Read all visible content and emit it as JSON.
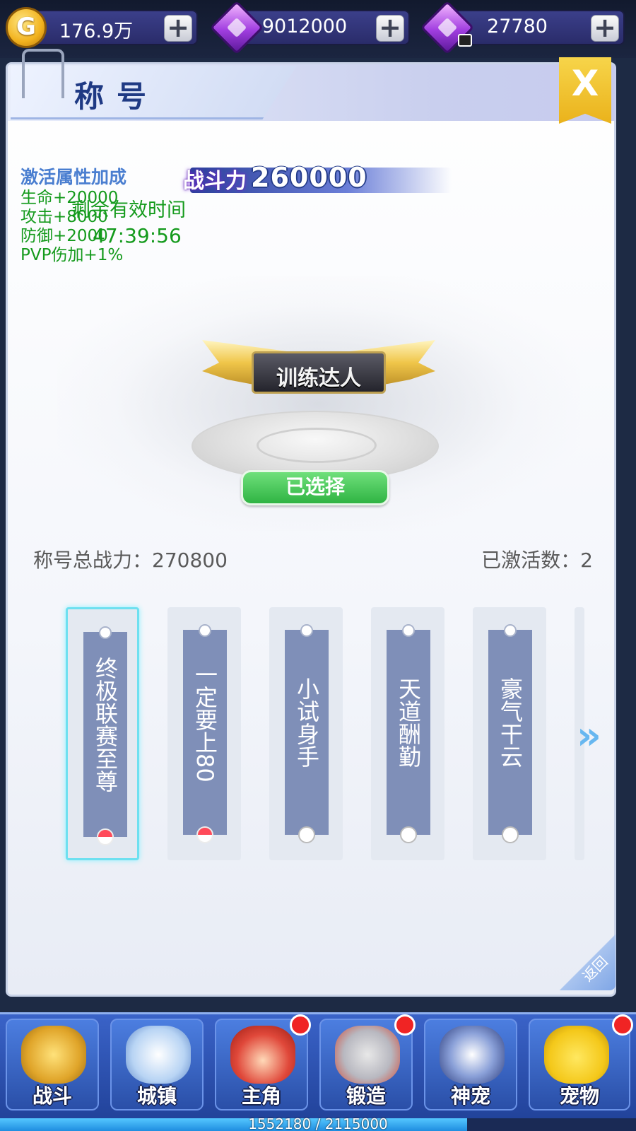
{
  "currency": {
    "gold": "176.9万",
    "diamond": "9012000",
    "locked_diamond": "27780",
    "coin_letter": "G",
    "add_symbol": "+"
  },
  "panel": {
    "title": "称号",
    "close_symbol": "X",
    "return_label": "返回"
  },
  "attributes": {
    "title": "激活属性加成",
    "lines": [
      "生命+20000",
      "攻击+8000",
      "防御+2000",
      "PVP伤加+1%"
    ],
    "remaining_label": "剩余有效时间",
    "remaining_time": "47:39:56"
  },
  "power": {
    "label": "战斗力",
    "value": "260000"
  },
  "showcase": {
    "title_badge": "训练达人",
    "selected_button": "已选择"
  },
  "stats": {
    "total_power": "称号总战力：270800",
    "active_count": "已激活数：2"
  },
  "cards": [
    {
      "name": "终极联赛至尊",
      "selected": true,
      "activated": true
    },
    {
      "name": "一定要上80",
      "selected": false,
      "activated": true
    },
    {
      "name": "小试身手",
      "selected": false,
      "activated": false
    },
    {
      "name": "天道酬勤",
      "selected": false,
      "activated": false
    },
    {
      "name": "豪气干云",
      "selected": false,
      "activated": false
    }
  ],
  "next_arrow": "»",
  "nav": [
    {
      "label": "战斗",
      "icon": "battle-icon",
      "dot": false
    },
    {
      "label": "城镇",
      "icon": "town-icon",
      "dot": false
    },
    {
      "label": "主角",
      "icon": "hero-icon",
      "dot": true
    },
    {
      "label": "锻造",
      "icon": "forge-icon",
      "dot": true
    },
    {
      "label": "神宠",
      "icon": "divine-pet-icon",
      "dot": false
    },
    {
      "label": "宠物",
      "icon": "pet-icon",
      "dot": true
    }
  ],
  "experience": {
    "text": "1552180 / 2115000",
    "fraction": 0.734
  }
}
